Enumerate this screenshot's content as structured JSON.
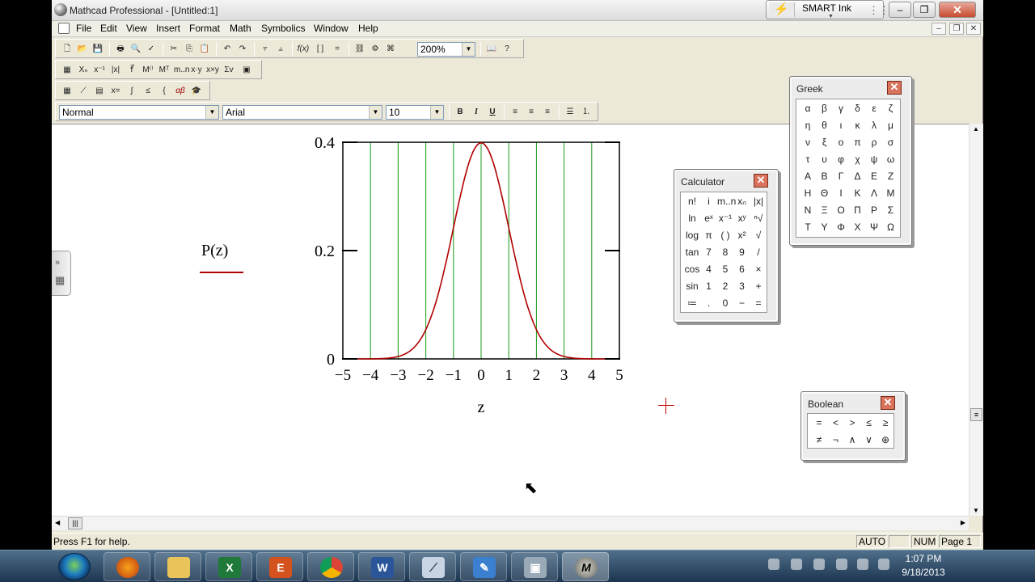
{
  "window": {
    "title": "Mathcad Professional - [Untitled:1]"
  },
  "smart_ink": {
    "label": "SMART Ink"
  },
  "menu": [
    "File",
    "Edit",
    "View",
    "Insert",
    "Format",
    "Math",
    "Symbolics",
    "Window",
    "Help"
  ],
  "toolbar": {
    "zoom": "200%"
  },
  "formatting": {
    "style": "Normal",
    "font": "Arial",
    "size": "10",
    "bold": "B",
    "italic": "I",
    "underline": "U"
  },
  "plot": {
    "y_label": "P(z)",
    "x_label": "z",
    "y_ticks": [
      "0.4",
      "0.2",
      "0"
    ],
    "x_ticks": [
      "−5",
      "−4",
      "−3",
      "−2",
      "−1",
      "0",
      "1",
      "2",
      "3",
      "4",
      "5"
    ],
    "xlim": [
      -5,
      5
    ],
    "ylim": [
      0,
      0.4
    ],
    "curve_color": "#b00000",
    "grid_color": "#1a9a1a"
  },
  "palettes": {
    "greek": {
      "title": "Greek",
      "rows": [
        [
          "α",
          "β",
          "γ",
          "δ",
          "ε",
          "ζ"
        ],
        [
          "η",
          "θ",
          "ι",
          "κ",
          "λ",
          "μ"
        ],
        [
          "ν",
          "ξ",
          "ο",
          "π",
          "ρ",
          "σ"
        ],
        [
          "τ",
          "υ",
          "φ",
          "χ",
          "ψ",
          "ω"
        ],
        [
          "Α",
          "Β",
          "Γ",
          "Δ",
          "Ε",
          "Ζ"
        ],
        [
          "Η",
          "Θ",
          "Ι",
          "Κ",
          "Λ",
          "Μ"
        ],
        [
          "Ν",
          "Ξ",
          "Ο",
          "Π",
          "Ρ",
          "Σ"
        ],
        [
          "Τ",
          "Υ",
          "Φ",
          "Χ",
          "Ψ",
          "Ω"
        ]
      ]
    },
    "calculator": {
      "title": "Calculator",
      "rows": [
        [
          "n!",
          "i",
          "m..n",
          "xₙ",
          "|x|"
        ],
        [
          "ln",
          "eˣ",
          "x⁻¹",
          "xʸ",
          "ⁿ√"
        ],
        [
          "log",
          "π",
          "( )",
          "x²",
          "√"
        ],
        [
          "tan",
          "7",
          "8",
          "9",
          "/"
        ],
        [
          "cos",
          "4",
          "5",
          "6",
          "×"
        ],
        [
          "sin",
          "1",
          "2",
          "3",
          "+"
        ],
        [
          "≔",
          ".",
          "0",
          "−",
          "="
        ]
      ]
    },
    "boolean": {
      "title": "Boolean",
      "rows": [
        [
          "=",
          "<",
          ">",
          "≤",
          "≥"
        ],
        [
          "≠",
          "¬",
          "∧",
          "∨",
          "⊕"
        ]
      ]
    }
  },
  "status": {
    "help": "Press F1 for help.",
    "auto": "AUTO",
    "num": "NUM",
    "page": "Page 1"
  },
  "clock": {
    "time": "1:07 PM",
    "date": "9/18/2013"
  }
}
